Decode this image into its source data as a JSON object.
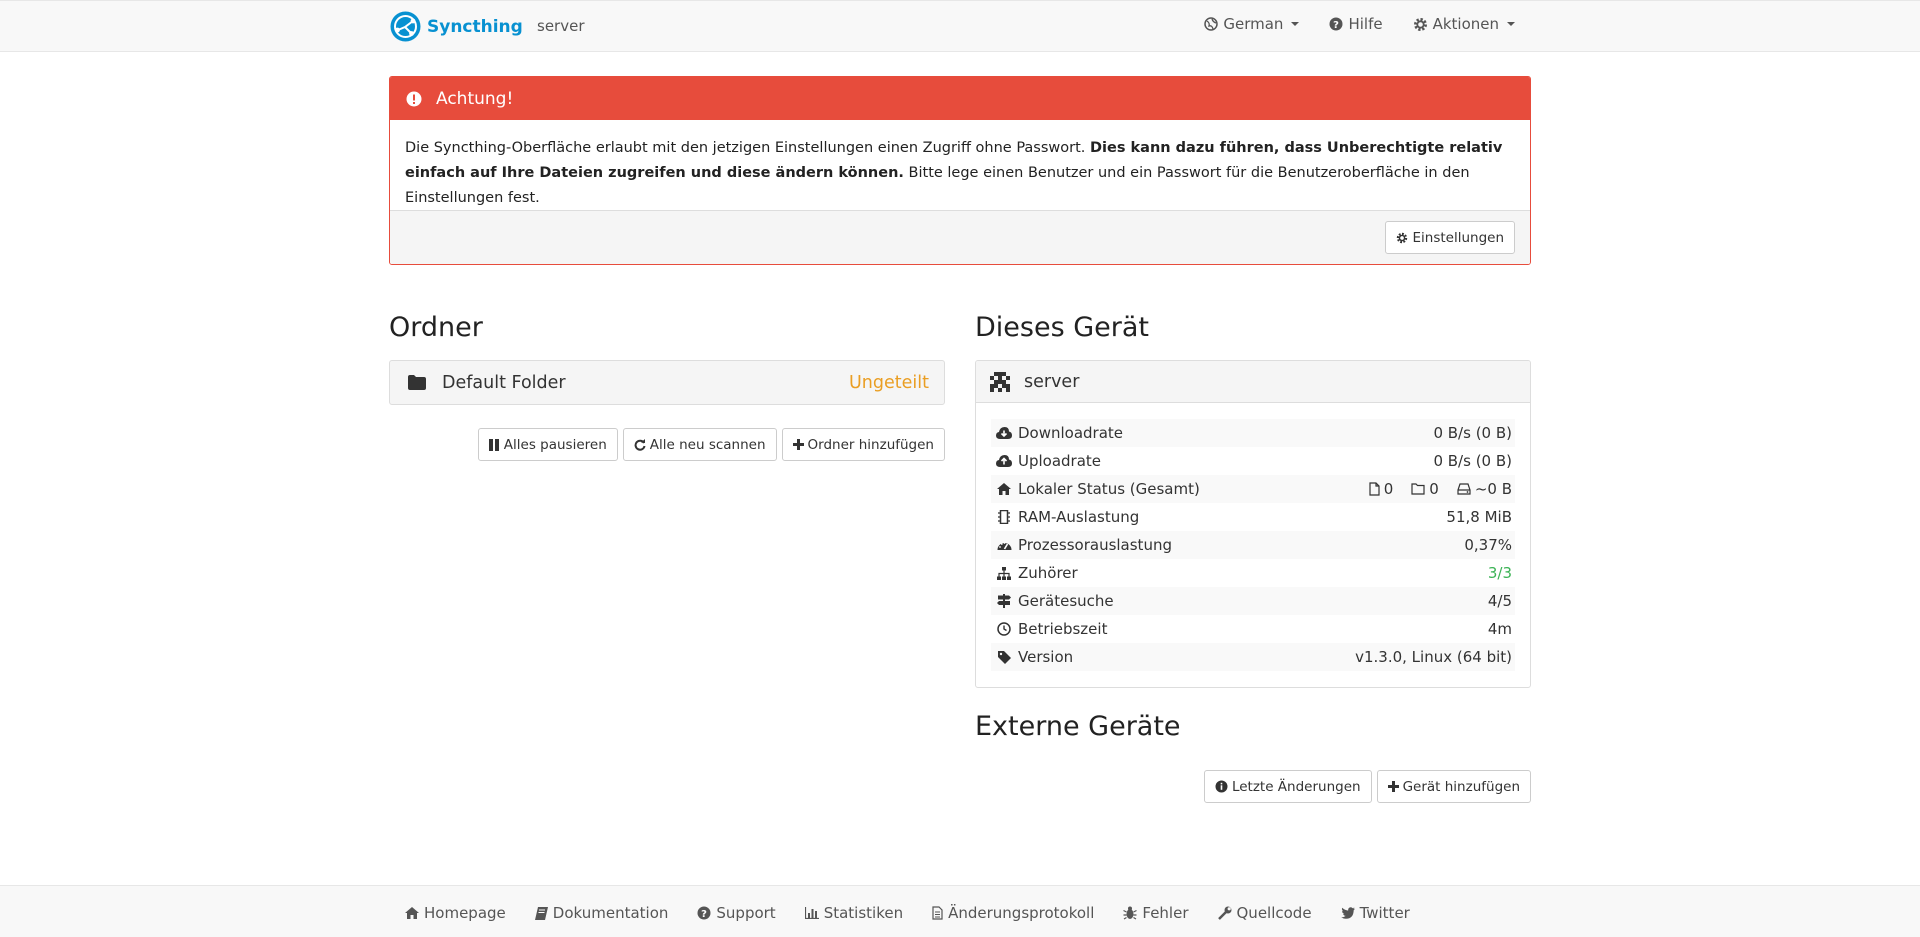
{
  "navbar": {
    "brand": "Syncthing",
    "device_name": "server",
    "language": "German",
    "help": "Hilfe",
    "actions": "Aktionen"
  },
  "alert": {
    "title": "Achtung!",
    "text_plain_1": "Die Syncthing-Oberfläche erlaubt mit den jetzigen Einstellungen einen Zugriff ohne Passwort. ",
    "text_bold": "Dies kann dazu führen, dass Unberechtigte relativ einfach auf Ihre Dateien zugreifen und diese ändern können.",
    "text_plain_2": " Bitte lege einen Benutzer und ein Passwort für die Benutzeroberfläche in den Einstellungen fest.",
    "settings_button": "Einstellungen"
  },
  "folders": {
    "title": "Ordner",
    "items": [
      {
        "name": "Default Folder",
        "status": "Ungeteilt"
      }
    ],
    "pause_all": "Alles pausieren",
    "rescan_all": "Alle neu scannen",
    "add_folder": "Ordner hinzufügen"
  },
  "this_device": {
    "title": "Dieses Gerät",
    "name": "server",
    "stats": {
      "download": {
        "label": "Downloadrate",
        "value": "0 B/s (0 B)"
      },
      "upload": {
        "label": "Uploadrate",
        "value": "0 B/s (0 B)"
      },
      "local_state": {
        "label": "Lokaler Status (Gesamt)",
        "files": "0",
        "dirs": "0",
        "size": "~0 B"
      },
      "ram": {
        "label": "RAM-Auslastung",
        "value": "51,8 MiB"
      },
      "cpu": {
        "label": "Prozessorauslastung",
        "value": "0,37%"
      },
      "listeners": {
        "label": "Zuhörer",
        "value": "3/3",
        "color": "#3cb356"
      },
      "discovery": {
        "label": "Gerätesuche",
        "value": "4/5"
      },
      "uptime": {
        "label": "Betriebszeit",
        "value": "4m"
      },
      "version": {
        "label": "Version",
        "value": "v1.3.0, Linux (64 bit)"
      }
    }
  },
  "remote_devices": {
    "title": "Externe Geräte",
    "recent_changes": "Letzte Änderungen",
    "add_device": "Gerät hinzufügen"
  },
  "footer": {
    "links": {
      "homepage": "Homepage",
      "docs": "Dokumentation",
      "support": "Support",
      "stats": "Statistiken",
      "changelog": "Änderungsprotokoll",
      "bugs": "Fehler",
      "source": "Quellcode",
      "twitter": "Twitter"
    }
  },
  "colors": {
    "brand": "#0891d1",
    "danger": "#e74c3c",
    "warning": "#ea9e23",
    "success": "#3cb356"
  }
}
